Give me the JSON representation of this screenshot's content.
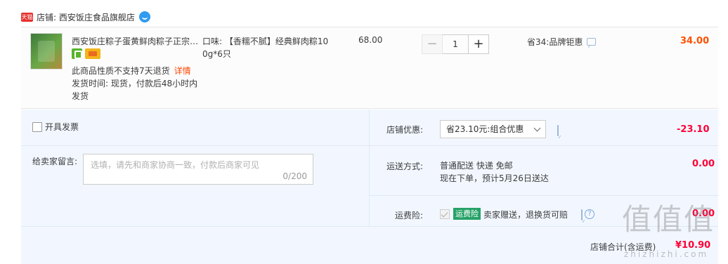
{
  "shop": {
    "badge": "天猫",
    "label": "店铺: 西安饭庄食品旗舰店"
  },
  "item": {
    "title": "西安饭庄粽子蛋黄鲜肉粽子正宗陕西特产",
    "no_refund": "此商品性质不支持7天退货",
    "detail_link": "详情",
    "ship_time": "发货时间: 现货，付款后48小时内发货",
    "sku": "口味: 【香糯不腻】经典鲜肉粽100g*6只",
    "unit_price": "68.00",
    "quantity": "1",
    "minus": "−",
    "plus": "+",
    "promo": "省34:品牌钜惠",
    "subtotal": "34.00"
  },
  "options": {
    "invoice_label": "开具发票",
    "memo_label": "给卖家留言:",
    "memo_placeholder": "选填，请先和商家协商一致，付款后商家可见",
    "memo_count": "0/200",
    "discount_label": "店铺优惠:",
    "discount_select": "省23.10元:组合优惠",
    "discount_amount": "-23.10",
    "shipping_label": "运送方式:",
    "shipping_method": "普通配送 快递 免邮",
    "shipping_eta": "现在下单，预计5月26日送达",
    "shipping_amount": "0.00",
    "insurance_label": "运费险:",
    "insurance_tag": "运费险",
    "insurance_text": "卖家赠送，退换货可赔",
    "insurance_amount": "0.00"
  },
  "total": {
    "label": "店铺合计(含运费)",
    "value": "¥10.90"
  },
  "watermark": {
    "text": "值值值",
    "sub": "zhizhizhi.com"
  }
}
